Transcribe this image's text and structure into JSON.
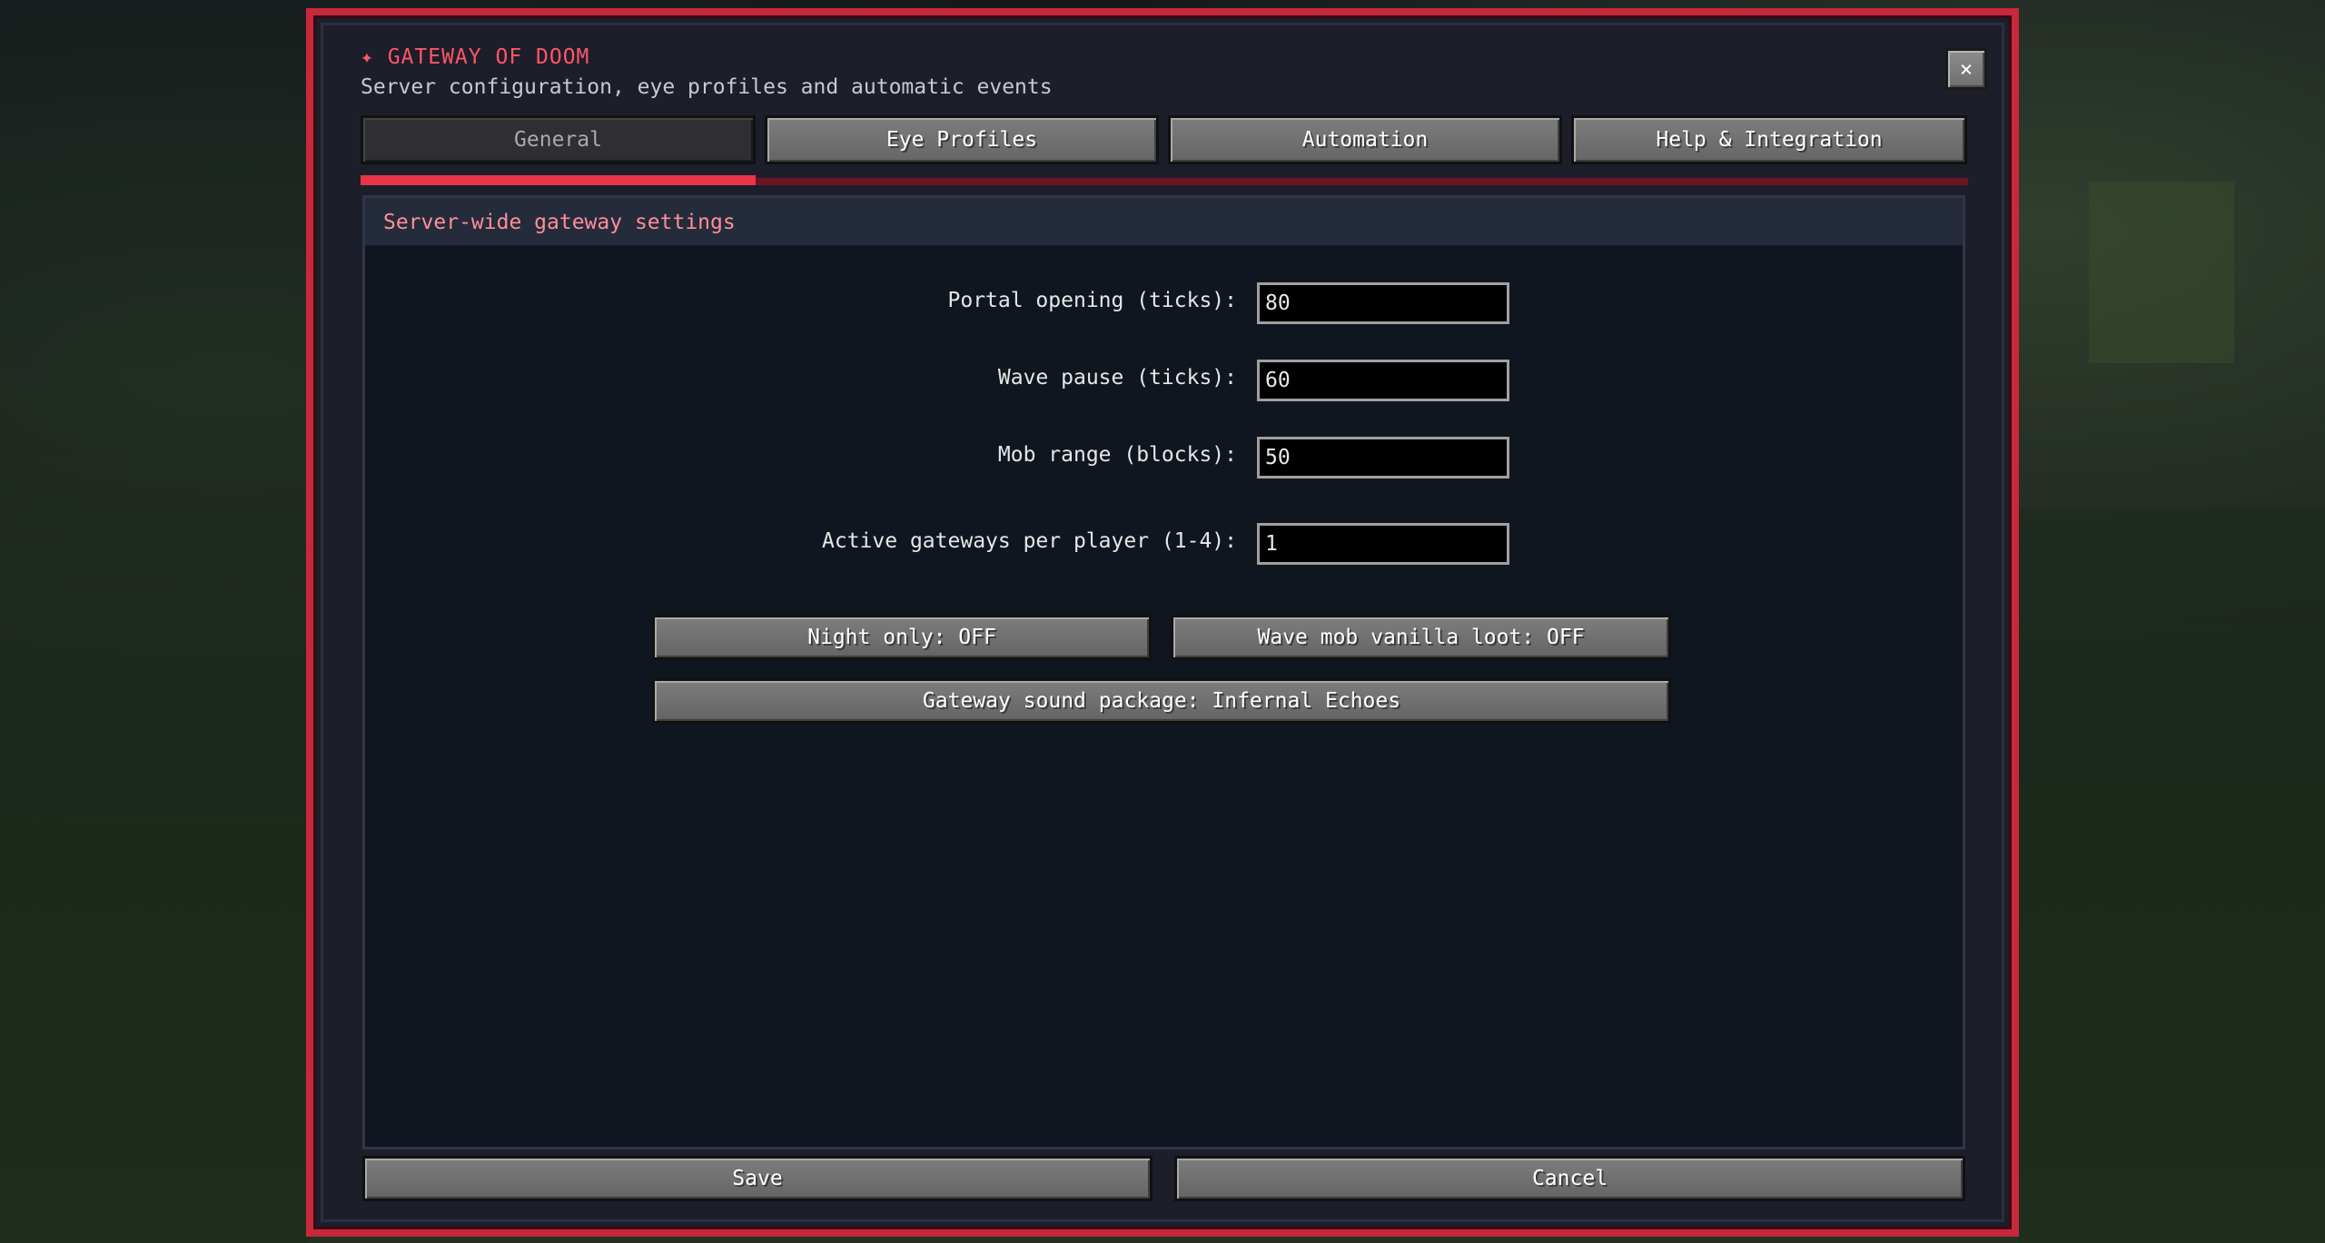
{
  "header": {
    "title": "✦ GATEWAY OF DOOM",
    "subtitle": "Server configuration, eye profiles and automatic events",
    "close_label": "×"
  },
  "tabs": [
    {
      "label": "General",
      "active": true
    },
    {
      "label": "Eye Profiles",
      "active": false
    },
    {
      "label": "Automation",
      "active": false
    },
    {
      "label": "Help & Integration",
      "active": false
    }
  ],
  "panel": {
    "heading": "Server-wide gateway settings",
    "fields": [
      {
        "label": "Portal opening (ticks):",
        "value": "80"
      },
      {
        "label": "Wave pause (ticks):",
        "value": "60"
      },
      {
        "label": "Mob range (blocks):",
        "value": "50"
      },
      {
        "label": "Active gateways per player (1-4):",
        "value": "1"
      }
    ],
    "toggles": {
      "night_only": "Night only: OFF",
      "vanilla_loot": "Wave mob vanilla loot: OFF",
      "sound_package": "Gateway sound package: Infernal Echoes"
    }
  },
  "footer": {
    "save_label": "Save",
    "cancel_label": "Cancel"
  },
  "colors": {
    "frame": "#c8283c",
    "accent": "#e83446",
    "title": "#ff5566",
    "panel_heading": "#ff8e99"
  }
}
